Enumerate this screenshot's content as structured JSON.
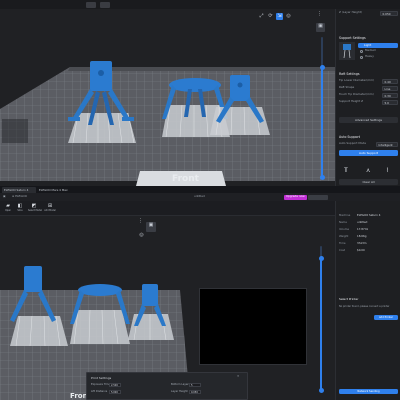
{
  "colors": {
    "accent": "#2f80ed",
    "model": "#2a78c8",
    "support": "#c9ccd1",
    "plate": "#5e6066",
    "grid": "#85888f",
    "panel": "#1e1f22",
    "magenta_badge": "#c22fd6"
  },
  "top": {
    "side": {
      "layer_height_label": "Z (Layer Height)",
      "layer_height_value": "0.050",
      "support_settings_title": "Support Settings",
      "support_options": [
        "Light",
        "Medium",
        "Heavy"
      ],
      "raft_settings_title": "Raft Settings",
      "raft_rows": [
        {
          "label": "Tip Lower Diameter(mm)",
          "value": "0.40"
        },
        {
          "label": "Raft Shape",
          "value": "Line"
        },
        {
          "label": "Touch Tip Diameter(mm)",
          "value": "0.30"
        },
        {
          "label": "Support Height Z",
          "value": "5.0"
        }
      ],
      "advanced_label": "Advanced Settings",
      "auto_support_title": "Auto Support",
      "auto_support_mode_label": "Auto Support Mode",
      "auto_support_mode_value": "Intelligent",
      "auto_support_button": "Auto Support",
      "clear_all_label": "Clear All"
    },
    "front_label": "Front",
    "toolbar_icons": [
      "move-icon",
      "rotate-icon",
      "scale-icon",
      "view-icon",
      "more-icon"
    ]
  },
  "bottom": {
    "tabs": [
      "ELEGOO Saturn 4",
      "ELEGOO Mars 4 Max"
    ],
    "menubar_title": "untitled",
    "badge_label": "Upgrade now",
    "toolbar": [
      {
        "icon": "open-icon",
        "label": "Open"
      },
      {
        "icon": "slice-icon",
        "label": "Slice"
      },
      {
        "icon": "select-model-icon",
        "label": "Select Model"
      },
      {
        "icon": "add-model-icon",
        "label": "Add Model"
      }
    ],
    "side": {
      "info": [
        {
          "k": "Machine",
          "v": "ELEGOO Saturn 4"
        },
        {
          "k": "Name",
          "v": "untitled"
        },
        {
          "k": "Volume",
          "v": "17.87ml"
        },
        {
          "k": "Weight",
          "v": "18.66g"
        },
        {
          "k": "Time",
          "v": "3h13m"
        },
        {
          "k": "Cost",
          "v": "$0.00"
        }
      ],
      "select_printer_title": "Select Printer",
      "select_printer_hint": "No printer found, please connect a printer",
      "add_printer_button": "Add Printer",
      "network_button": "Network Sending"
    },
    "print_settings": {
      "title": "Print Settings",
      "fields": [
        {
          "k": "Exposure Time",
          "v": "2.500"
        },
        {
          "k": "Lift Distance",
          "v": "5.000"
        },
        {
          "k": "Bottom Layers",
          "v": "5"
        },
        {
          "k": "Layer Height",
          "v": "0.050"
        }
      ]
    },
    "front_label": "Front"
  }
}
